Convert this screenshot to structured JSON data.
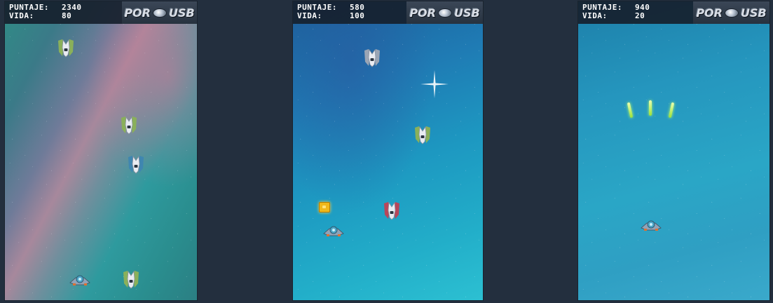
{
  "hud_labels": {
    "score": "PUNTAJE:",
    "life": "VIDA:"
  },
  "logo": {
    "text_left": "POR",
    "text_right": "USB"
  },
  "panels": [
    {
      "score": "2340",
      "life": "80"
    },
    {
      "score": "580",
      "life": "100"
    },
    {
      "score": "940",
      "life": "20"
    }
  ],
  "colors": {
    "hud_background": "#16202d",
    "page_background": "#232f3e",
    "enemy_green": "#8ab05a",
    "enemy_blue": "#3f86b0",
    "enemy_red": "#b7465a",
    "coin": "#f0b81a",
    "laser": "#9be23a"
  },
  "icons": [
    "enemy-ship-icon",
    "player-ship-icon",
    "coin-icon",
    "laser-shot-icon",
    "star-sparkle-icon",
    "logo-badge-icon"
  ]
}
